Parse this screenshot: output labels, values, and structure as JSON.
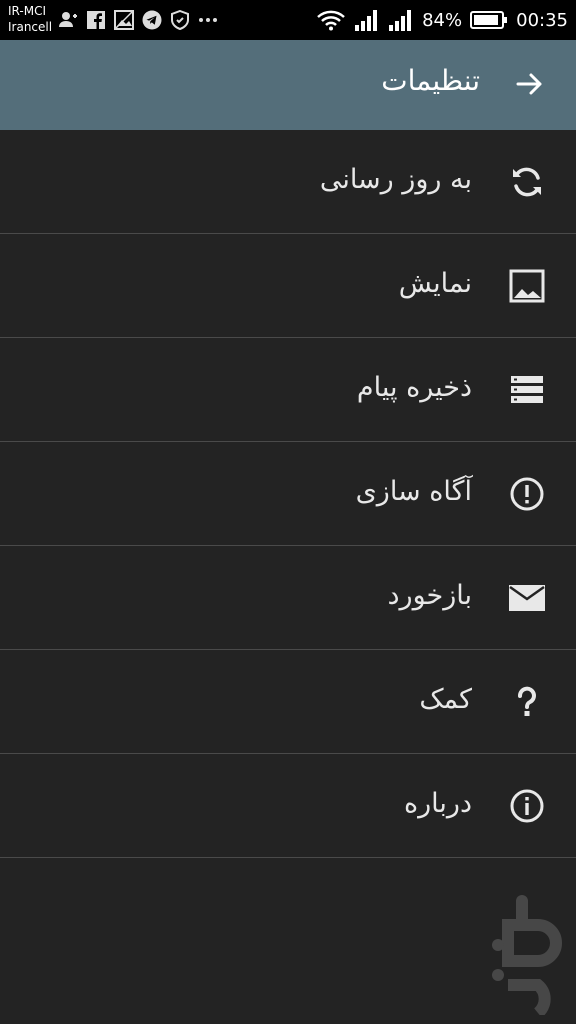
{
  "status_bar": {
    "carrier_1": "IR-MCI",
    "carrier_2": "Irancell",
    "battery": "84%",
    "time": "00:35",
    "icons": [
      "add-contact-icon",
      "facebook-icon",
      "image-icon",
      "telegram-icon",
      "shield-icon",
      "more-icon",
      "wifi-icon",
      "signal-icon",
      "signal-icon",
      "battery-icon"
    ]
  },
  "app_bar": {
    "title": "تنظیمات",
    "back_icon": "arrow-forward-icon",
    "color": "#546e7a"
  },
  "menu": {
    "items": [
      {
        "label": "به روز رسانی",
        "icon": "refresh-icon"
      },
      {
        "label": "نمایش",
        "icon": "image-icon"
      },
      {
        "label": "ذخیره پیام",
        "icon": "storage-icon"
      },
      {
        "label": "آگاه سازی",
        "icon": "alert-icon"
      },
      {
        "label": "بازخورد",
        "icon": "mail-icon"
      },
      {
        "label": "کمک",
        "icon": "help-icon"
      },
      {
        "label": "درباره",
        "icon": "info-icon"
      }
    ]
  },
  "colors": {
    "background": "#232323",
    "divider": "#4a4a4a",
    "text": "#e8e8e8"
  }
}
